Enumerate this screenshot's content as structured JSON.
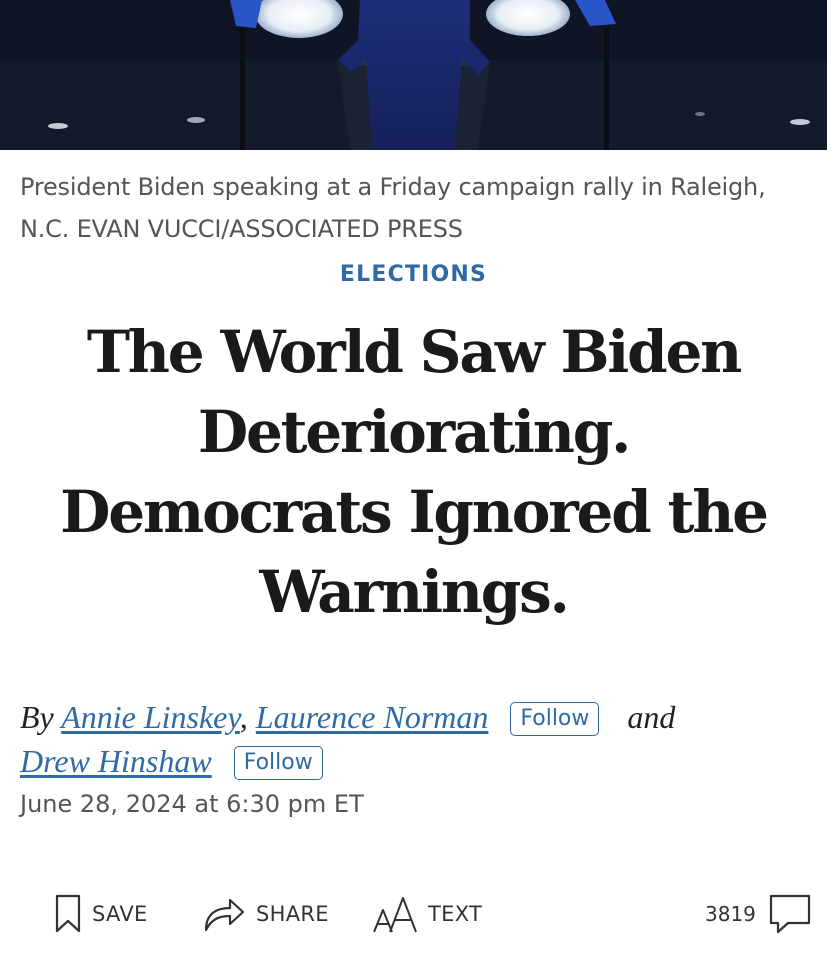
{
  "caption": {
    "line1": "President Biden speaking at a Friday campaign rally in Raleigh,",
    "line2": "N.C. EVAN VUCCI/ASSOCIATED PRESS"
  },
  "section": {
    "label": "ELECTIONS"
  },
  "headline": {
    "line1": "The World Saw Biden",
    "line2": "Deteriorating.",
    "line3": "Democrats Ignored the",
    "line4": "Warnings."
  },
  "byline": {
    "by": "By",
    "author1": "Annie Linskey",
    "comma": ",",
    "author2": "Laurence Norman",
    "follow1": "Follow",
    "and": "and",
    "author3": "Drew Hinshaw",
    "follow2": "Follow",
    "date": "June 28, 2024 at 6:30 pm ET"
  },
  "toolbar": {
    "save_label": "SAVE",
    "share_label": "SHARE",
    "text_label": "TEXT",
    "comment_count": "3819",
    "icons": {
      "save": "bookmark-icon",
      "share": "share-arrow-icon",
      "text": "text-size-icon",
      "comments": "comment-bubble-icon"
    }
  },
  "colors": {
    "accent": "#2f6aa3",
    "headline": "#1a1a1a",
    "caption": "#555555"
  }
}
